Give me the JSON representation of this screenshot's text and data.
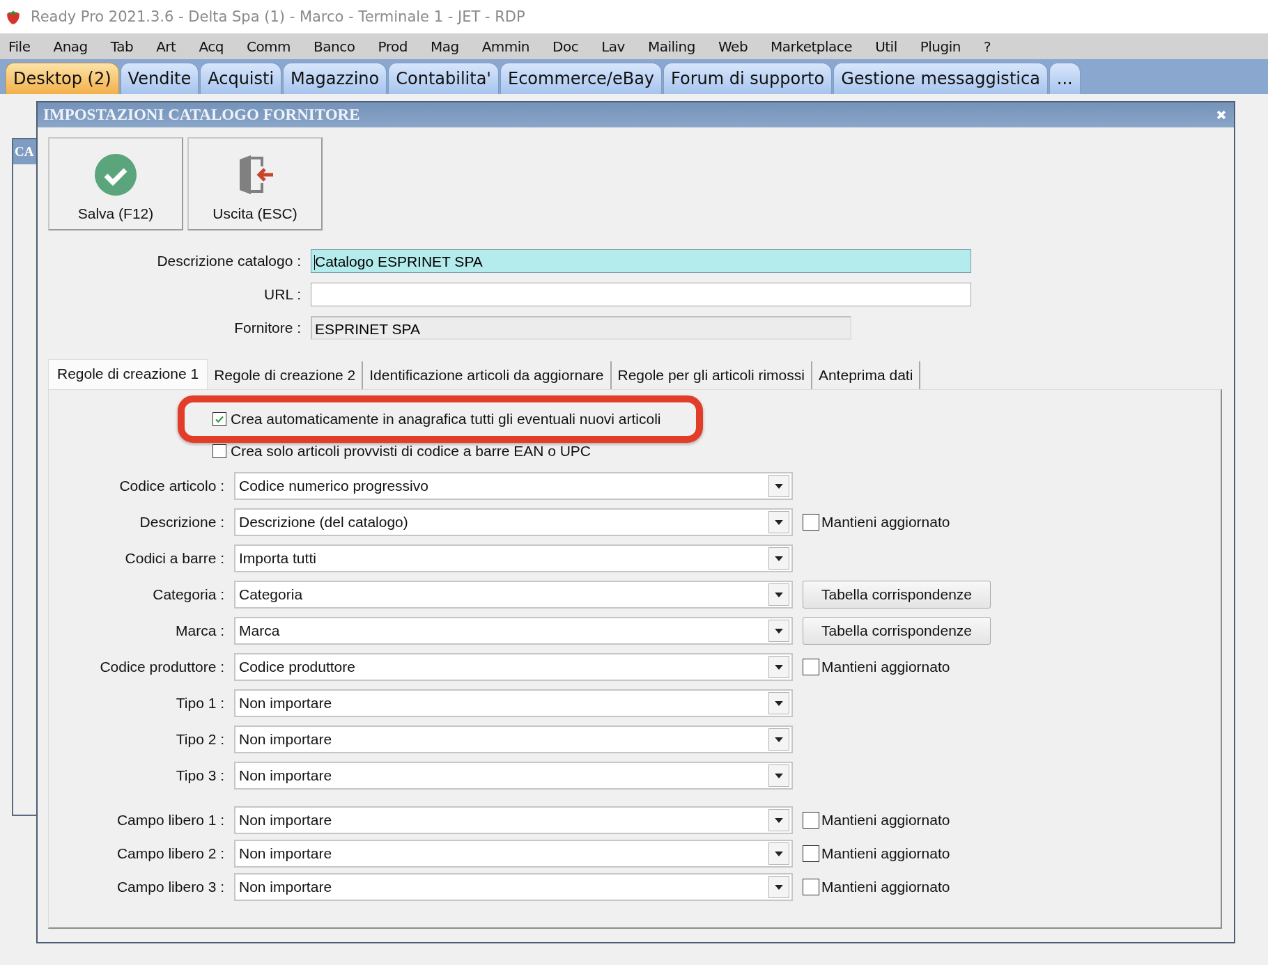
{
  "window": {
    "title": "Ready Pro 2021.3.6 - Delta Spa (1) - Marco - Terminale 1 - JET - RDP"
  },
  "menu": [
    "File",
    "Anag",
    "Tab",
    "Art",
    "Acq",
    "Comm",
    "Banco",
    "Prod",
    "Mag",
    "Ammin",
    "Doc",
    "Lav",
    "Mailing",
    "Web",
    "Marketplace",
    "Util",
    "Plugin",
    "?"
  ],
  "app_tabs": [
    {
      "label": "Desktop (2)",
      "selected": true
    },
    {
      "label": "Vendite",
      "selected": false
    },
    {
      "label": "Acquisti",
      "selected": false
    },
    {
      "label": "Magazzino",
      "selected": false
    },
    {
      "label": "Contabilita'",
      "selected": false
    },
    {
      "label": "Ecommerce/eBay",
      "selected": false
    },
    {
      "label": "Forum di supporto",
      "selected": false
    },
    {
      "label": "Gestione messaggistica",
      "selected": false
    },
    {
      "label": "...",
      "selected": false
    }
  ],
  "background_window": {
    "title": "CA"
  },
  "dialog": {
    "title": "IMPOSTAZIONI CATALOGO FORNITORE",
    "toolbar": [
      {
        "label": "Salva (F12)",
        "kind": "save"
      },
      {
        "label": "Uscita (ESC)",
        "kind": "exit"
      }
    ],
    "fields": [
      {
        "label": "Descrizione catalogo :",
        "value": "Catalogo ESPRINET SPA",
        "kind": "focused"
      },
      {
        "label": "URL :",
        "kind": "input"
      },
      {
        "label": "Fornitore :",
        "value": "ESPRINET SPA",
        "kind": "readonly"
      }
    ],
    "tabs": [
      {
        "label": "Regole di creazione 1",
        "selected": true
      },
      {
        "label": "Regole di creazione 2",
        "selected": false
      },
      {
        "label": "Identificazione articoli da aggiornare",
        "selected": false
      },
      {
        "label": "Regole per gli articoli rimossi",
        "selected": false
      },
      {
        "label": "Anteprima dati",
        "selected": false
      }
    ],
    "options": [
      {
        "label": "Crea automaticamente in anagrafica tutti gli eventuali nuovi articoli",
        "checked": true,
        "highlighted": true
      },
      {
        "label": "Crea solo articoli provvisti di codice a barre EAN o UPC",
        "checked": false,
        "highlighted": false
      }
    ],
    "rules": [
      {
        "label": "Codice articolo :",
        "value": "Codice numerico progressivo"
      },
      {
        "label": "Descrizione :",
        "value": "Descrizione (del catalogo)",
        "extra": {
          "kind": "checkbox",
          "label": "Mantieni aggiornato",
          "checked": false
        }
      },
      {
        "label": "Codici a barre :",
        "value": "Importa tutti"
      },
      {
        "label": "Categoria :",
        "value": "Categoria",
        "extra": {
          "kind": "button",
          "label": "Tabella corrispondenze"
        }
      },
      {
        "label": "Marca :",
        "value": "Marca",
        "extra": {
          "kind": "button",
          "label": "Tabella corrispondenze"
        }
      },
      {
        "label": "Codice produttore :",
        "value": "Codice produttore",
        "extra": {
          "kind": "checkbox",
          "label": "Mantieni aggiornato",
          "checked": false
        }
      },
      {
        "label": "Tipo 1 :",
        "value": "Non importare"
      },
      {
        "label": "Tipo 2 :",
        "value": "Non importare"
      },
      {
        "label": "Tipo 3 :",
        "value": "Non importare"
      }
    ],
    "free_rules": [
      {
        "label": "Campo libero 1 :",
        "value": "Non importare",
        "extra": {
          "kind": "checkbox",
          "label": "Mantieni aggiornato",
          "checked": false
        }
      },
      {
        "label": "Campo libero 2 :",
        "value": "Non importare",
        "extra": {
          "kind": "checkbox",
          "label": "Mantieni aggiornato",
          "checked": false
        }
      },
      {
        "label": "Campo libero 3 :",
        "value": "Non importare",
        "extra": {
          "kind": "checkbox",
          "label": "Mantieni aggiornato",
          "checked": false
        }
      }
    ]
  }
}
